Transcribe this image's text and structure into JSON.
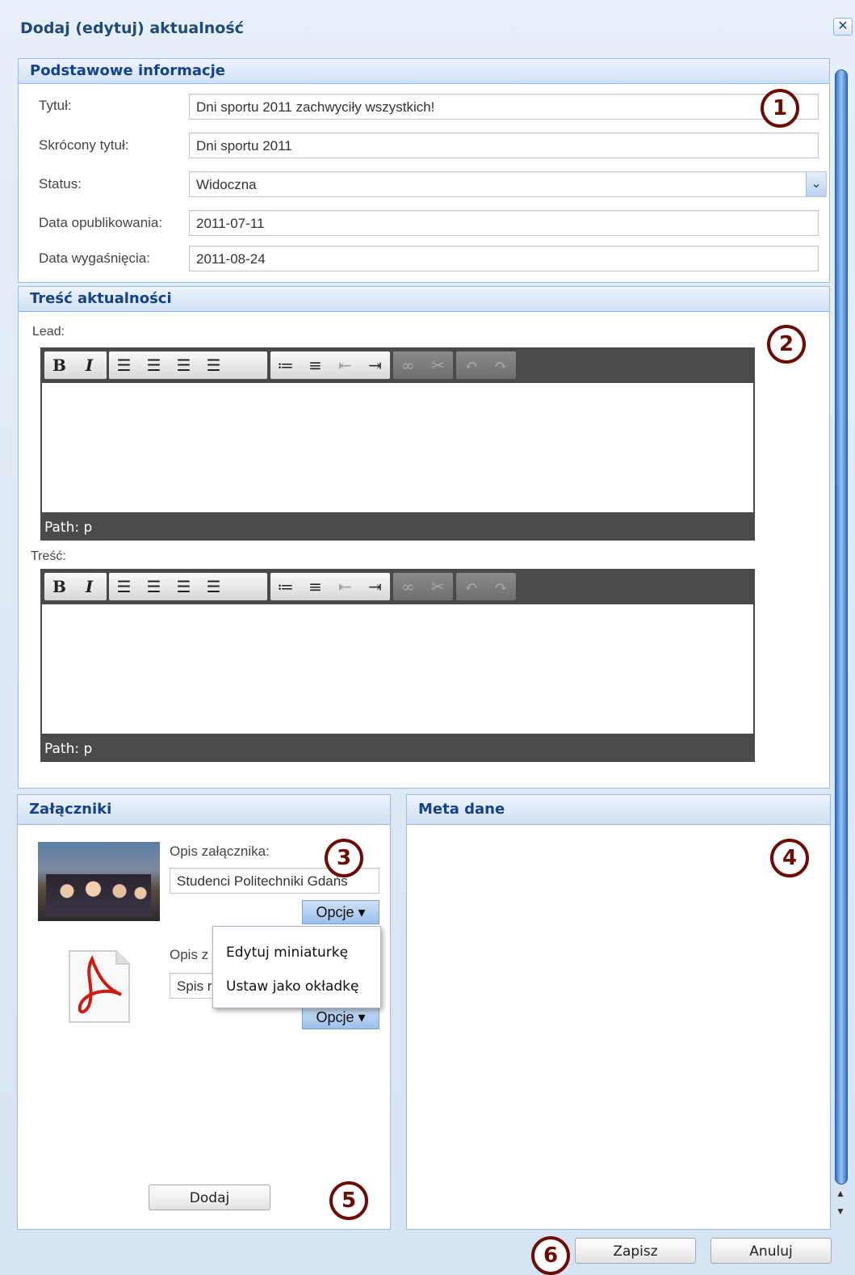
{
  "window": {
    "title": "Dodaj (edytuj) aktualność",
    "close_glyph": "✕"
  },
  "basic": {
    "header": "Podstawowe informacje",
    "fields": [
      {
        "label": "Tytuł:",
        "value": "Dni sportu 2011 zachwyciły wszystkich!"
      },
      {
        "label": "Skrócony tytuł:",
        "value": "Dni sportu 2011"
      },
      {
        "label": "Status:",
        "value": "Widoczna"
      },
      {
        "label": "Data opublikowania:",
        "value": "2011-07-11"
      },
      {
        "label": "Data wygaśnięcia:",
        "value": "2011-08-24"
      }
    ]
  },
  "content": {
    "header": "Treść aktualności",
    "lead_label": "Lead:",
    "body_label": "Treść:",
    "path_text": "Path: p",
    "toolbar": [
      "bold-icon",
      "italic-icon",
      "align-left-icon",
      "align-center-icon",
      "align-right-icon",
      "align-justify-icon",
      "bullet-list-icon",
      "numbered-list-icon",
      "outdent-icon",
      "indent-icon",
      "link-icon",
      "unlink-icon",
      "undo-icon",
      "redo-icon"
    ]
  },
  "attachments": {
    "header": "Załączniki",
    "items": [
      {
        "desc_label": "Opis załącznika:",
        "desc_value": "Studenci Politechniki Gdańs",
        "options": "Opcje ▾"
      },
      {
        "desc_label": "Opis z",
        "desc_value": "Spis r",
        "options": "Opcje ▾"
      }
    ],
    "menu": [
      "Edytuj miniaturkę",
      "Ustaw jako okładkę"
    ],
    "add_button": "Dodaj"
  },
  "meta": {
    "header": "Meta dane"
  },
  "footer": {
    "save": "Zapisz",
    "cancel": "Anuluj"
  },
  "badges": [
    "1",
    "2",
    "3",
    "4",
    "5",
    "6"
  ],
  "colors": {
    "header_text": "#15428b",
    "panel_border": "#99bbe8",
    "badge": "#6b0c05",
    "editor_dark": "#4a4a4a"
  }
}
